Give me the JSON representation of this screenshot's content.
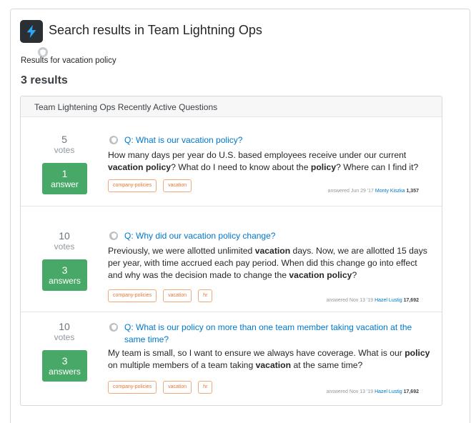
{
  "header": {
    "title": "Search results in Team Lightning Ops",
    "results_for": "Results for vacation policy",
    "results_count": "3 results"
  },
  "panel": {
    "title": "Team Lightening Ops Recently Active Questions"
  },
  "colors": {
    "accent": "#0077cc",
    "answered": "#48a868",
    "tag": "#e8762d"
  },
  "questions": [
    {
      "votes": "5",
      "votes_label": "votes",
      "answers": "1",
      "answers_label": "answer",
      "title": "Q: What is our vacation policy?",
      "excerpt": [
        {
          "t": "How many days per year do U.S. based employees receive under our current ",
          "b": false
        },
        {
          "t": "vacation policy",
          "b": true
        },
        {
          "t": "? What do I need to know about the ",
          "b": false
        },
        {
          "t": "policy",
          "b": true
        },
        {
          "t": "? Where can I find it?",
          "b": false
        }
      ],
      "tags": [
        "company-policies",
        "vacation"
      ],
      "answered": "answered Jun 29 '17",
      "user": "Monty Kiszka",
      "rep": "1,357"
    },
    {
      "votes": "10",
      "votes_label": "votes",
      "answers": "3",
      "answers_label": "answers",
      "title": "Q: Why did our vacation policy change?",
      "excerpt": [
        {
          "t": "Previously, we were allotted unlimited ",
          "b": false
        },
        {
          "t": "vacation",
          "b": true
        },
        {
          "t": " days. Now, we are allotted 15 days per year, with time accrued each pay period. When did this change go into effect and why was the decision made to change the ",
          "b": false
        },
        {
          "t": "vacation policy",
          "b": true
        },
        {
          "t": "?",
          "b": false
        }
      ],
      "tags": [
        "company-policies",
        "vacation",
        "hr"
      ],
      "answered": "answered Nov 13 '19",
      "user": "Hazel Lustig",
      "rep": "17,692"
    },
    {
      "votes": "10",
      "votes_label": "votes",
      "answers": "3",
      "answers_label": "answers",
      "title": "Q: What is our policy on more than one team member taking vacation at the same time?",
      "excerpt": [
        {
          "t": "My team is small, so I want to ensure we always have coverage. What is our ",
          "b": false
        },
        {
          "t": "policy",
          "b": true
        },
        {
          "t": " on multiple members of a team taking ",
          "b": false
        },
        {
          "t": "vacation",
          "b": true
        },
        {
          "t": " at the same time?",
          "b": false
        }
      ],
      "tags": [
        "company-policies",
        "vacation",
        "hr"
      ],
      "answered": "answered Nov 13 '19",
      "user": "Hazel Lustig",
      "rep": "17,692"
    }
  ]
}
